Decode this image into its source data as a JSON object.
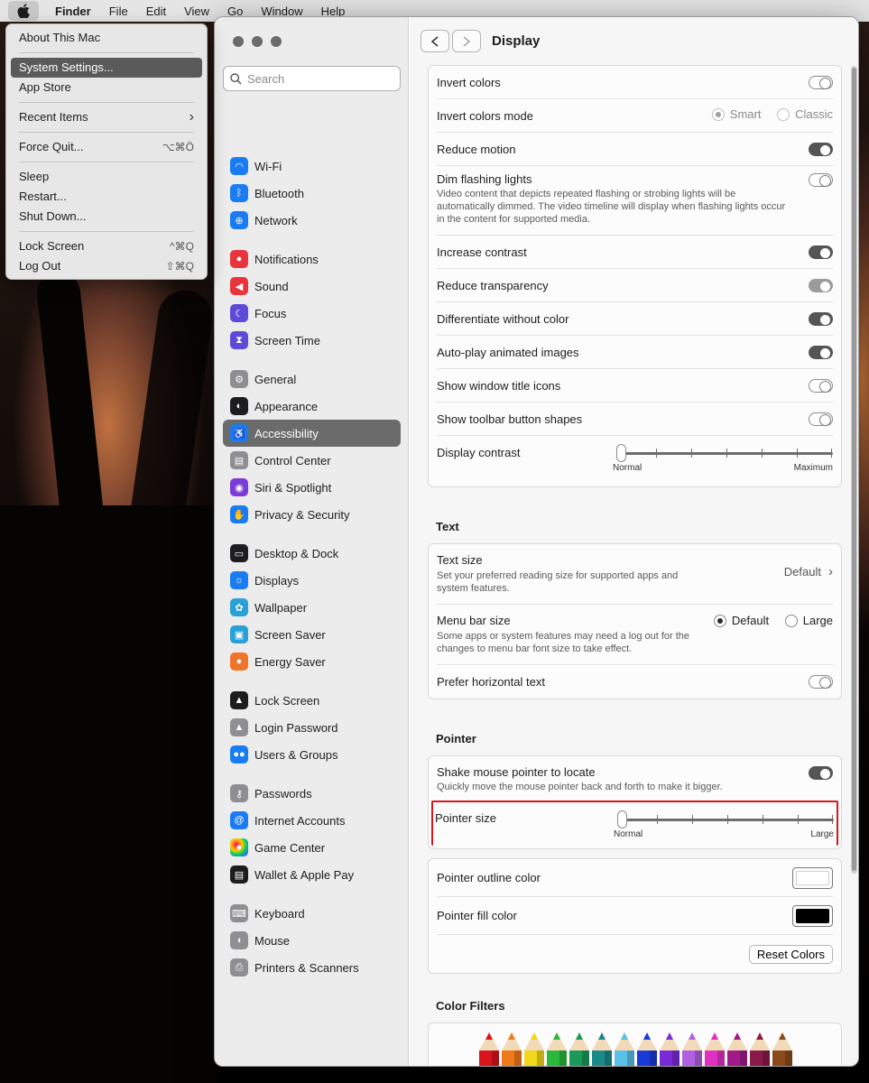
{
  "menubar": {
    "app": "Finder",
    "items": [
      "File",
      "Edit",
      "View",
      "Go",
      "Window",
      "Help"
    ]
  },
  "apple_menu": {
    "groups": [
      [
        {
          "label": "About This Mac",
          "shortcut": ""
        }
      ],
      [
        {
          "label": "System Settings...",
          "shortcut": "",
          "highlighted": true
        },
        {
          "label": "App Store",
          "shortcut": ""
        }
      ],
      [
        {
          "label": "Recent Items",
          "shortcut": "›"
        }
      ],
      [
        {
          "label": "Force Quit...",
          "shortcut": "⌥⌘Ö"
        }
      ],
      [
        {
          "label": "Sleep",
          "shortcut": ""
        },
        {
          "label": "Restart...",
          "shortcut": ""
        },
        {
          "label": "Shut Down...",
          "shortcut": ""
        }
      ],
      [
        {
          "label": "Lock Screen",
          "shortcut": "^⌘Q"
        },
        {
          "label": "Log Out",
          "shortcut": "⇧⌘Q"
        }
      ]
    ]
  },
  "sidebar": {
    "search_placeholder": "Search",
    "groups": [
      [
        {
          "label": "Wi-Fi",
          "icon": "wifi-icon",
          "color": "#1a7cf2",
          "glyph": "◠"
        },
        {
          "label": "Bluetooth",
          "icon": "bluetooth-icon",
          "color": "#1a7cf2",
          "glyph": "ᛒ"
        },
        {
          "label": "Network",
          "icon": "globe-icon",
          "color": "#1a7cf2",
          "glyph": "⊕"
        }
      ],
      [
        {
          "label": "Notifications",
          "icon": "bell-icon",
          "color": "#e8343a",
          "glyph": "●"
        },
        {
          "label": "Sound",
          "icon": "speaker-icon",
          "color": "#e8343a",
          "glyph": "◀"
        },
        {
          "label": "Focus",
          "icon": "moon-icon",
          "color": "#5b4bd6",
          "glyph": "☾"
        },
        {
          "label": "Screen Time",
          "icon": "hourglass-icon",
          "color": "#5b4bd6",
          "glyph": "⧗"
        }
      ],
      [
        {
          "label": "General",
          "icon": "gear-icon",
          "color": "#8e8e93",
          "glyph": "⚙"
        },
        {
          "label": "Appearance",
          "icon": "appearance-icon",
          "color": "#1d1d1f",
          "glyph": "◐"
        },
        {
          "label": "Accessibility",
          "icon": "accessibility-icon",
          "color": "#1a7cf2",
          "glyph": "♿",
          "active": true
        },
        {
          "label": "Control Center",
          "icon": "control-center-icon",
          "color": "#8e8e93",
          "glyph": "▤"
        },
        {
          "label": "Siri & Spotlight",
          "icon": "siri-icon",
          "color": "#7a3bd6",
          "glyph": "◉"
        },
        {
          "label": "Privacy & Security",
          "icon": "hand-icon",
          "color": "#1a7cf2",
          "glyph": "✋"
        }
      ],
      [
        {
          "label": "Desktop & Dock",
          "icon": "dock-icon",
          "color": "#1d1d1f",
          "glyph": "▭"
        },
        {
          "label": "Displays",
          "icon": "sun-icon",
          "color": "#1a7cf2",
          "glyph": "☼"
        },
        {
          "label": "Wallpaper",
          "icon": "flower-icon",
          "color": "#29a0d6",
          "glyph": "✿"
        },
        {
          "label": "Screen Saver",
          "icon": "screensaver-icon",
          "color": "#29a0d6",
          "glyph": "▣"
        },
        {
          "label": "Energy Saver",
          "icon": "bulb-icon",
          "color": "#f0742a",
          "glyph": "●"
        }
      ],
      [
        {
          "label": "Lock Screen",
          "icon": "lock-icon",
          "color": "#1d1d1f",
          "glyph": "▲"
        },
        {
          "label": "Login Password",
          "icon": "padlock-icon",
          "color": "#8e8e93",
          "glyph": "▲"
        },
        {
          "label": "Users & Groups",
          "icon": "users-icon",
          "color": "#1a7cf2",
          "glyph": "●●"
        }
      ],
      [
        {
          "label": "Passwords",
          "icon": "key-icon",
          "color": "#8e8e93",
          "glyph": "⚷"
        },
        {
          "label": "Internet Accounts",
          "icon": "at-icon",
          "color": "#1a7cf2",
          "glyph": "@"
        },
        {
          "label": "Game Center",
          "icon": "game-center-icon",
          "color": "#ffffff",
          "glyph": "●"
        },
        {
          "label": "Wallet & Apple Pay",
          "icon": "wallet-icon",
          "color": "#1d1d1f",
          "glyph": "▤"
        }
      ],
      [
        {
          "label": "Keyboard",
          "icon": "keyboard-icon",
          "color": "#8e8e93",
          "glyph": "⌨"
        },
        {
          "label": "Mouse",
          "icon": "mouse-icon",
          "color": "#8e8e93",
          "glyph": "◖"
        },
        {
          "label": "Printers & Scanners",
          "icon": "printer-icon",
          "color": "#8e8e93",
          "glyph": "⎙"
        }
      ]
    ]
  },
  "main": {
    "title": "Display",
    "display_group": {
      "invert_colors": "Invert colors",
      "invert_mode": "Invert colors mode",
      "mode_smart": "Smart",
      "mode_classic": "Classic",
      "reduce_motion": "Reduce motion",
      "dim_flashing": "Dim flashing lights",
      "dim_flashing_desc": "Video content that depicts repeated flashing or strobing lights will be automatically dimmed. The video timeline will display when flashing lights occur in the content for supported media.",
      "increase_contrast": "Increase contrast",
      "reduce_transparency": "Reduce transparency",
      "differentiate": "Differentiate without color",
      "autoplay": "Auto-play animated images",
      "window_title_icons": "Show window title icons",
      "toolbar_shapes": "Show toolbar button shapes",
      "display_contrast": "Display contrast",
      "contrast_min": "Normal",
      "contrast_max": "Maximum",
      "contrast_value": 0
    },
    "text_section": {
      "title": "Text",
      "text_size": "Text size",
      "text_size_desc": "Set your preferred reading size for supported apps and system features.",
      "text_size_value": "Default",
      "menu_bar_size": "Menu bar size",
      "menu_bar_desc": "Some apps or system features may need a log out for the changes to menu bar font size to take effect.",
      "menu_default": "Default",
      "menu_large": "Large",
      "prefer_horizontal": "Prefer horizontal text"
    },
    "pointer_section": {
      "title": "Pointer",
      "shake": "Shake mouse pointer to locate",
      "shake_desc": "Quickly move the mouse pointer back and forth to make it bigger.",
      "pointer_size": "Pointer size",
      "size_min": "Normal",
      "size_max": "Large",
      "size_value": 0,
      "outline_color": "Pointer outline color",
      "outline_hex": "#ffffff",
      "fill_color": "Pointer fill color",
      "fill_hex": "#000000",
      "reset": "Reset Colors"
    },
    "color_filters": {
      "title": "Color Filters",
      "pencils": [
        "#d8141c",
        "#f07a1a",
        "#f0d81a",
        "#2ab83a",
        "#1a9a5a",
        "#1a8a8a",
        "#5ac0e8",
        "#1a3ad8",
        "#7a2ad8",
        "#b060e0",
        "#e030c0",
        "#a01a8a",
        "#8a1a4a",
        "#8a4a1a"
      ]
    }
  }
}
